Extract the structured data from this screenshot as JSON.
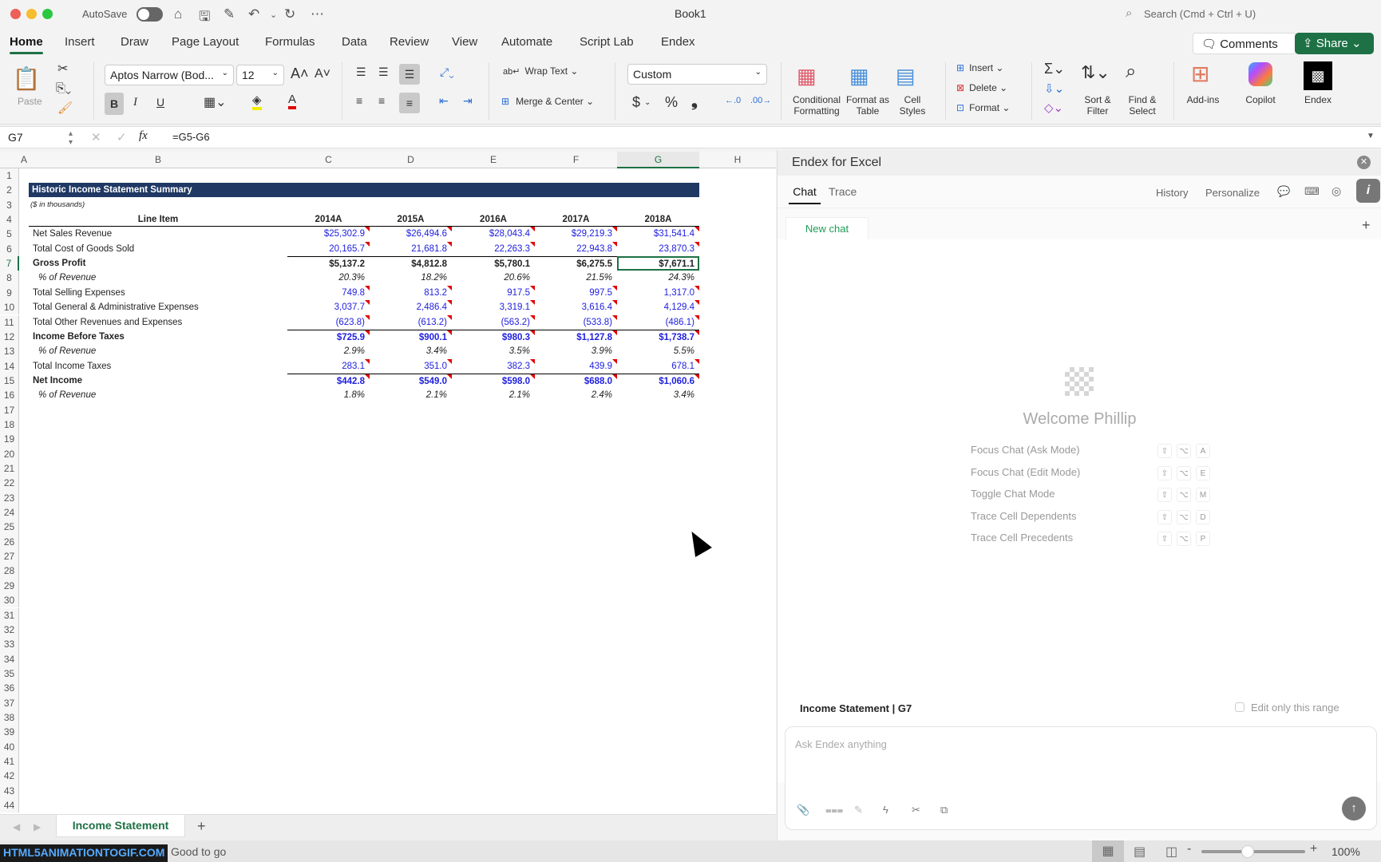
{
  "window": {
    "title": "Book1",
    "autosave_label": "AutoSave",
    "search_placeholder": "Search (Cmd + Ctrl + U)"
  },
  "menu": {
    "tabs": [
      "Home",
      "Insert",
      "Draw",
      "Page Layout",
      "Formulas",
      "Data",
      "Review",
      "View",
      "Automate",
      "Script Lab",
      "Endex"
    ],
    "comments": "Comments",
    "share": "Share"
  },
  "ribbon": {
    "paste": "Paste",
    "font_name": "Aptos Narrow (Bod...",
    "font_size": "12",
    "wrap_text": "Wrap Text",
    "merge_center": "Merge & Center",
    "number_format": "Custom",
    "conditional_formatting": "Conditional Formatting",
    "format_as_table": "Format as Table",
    "cell_styles": "Cell Styles",
    "insert": "Insert",
    "delete": "Delete",
    "format": "Format",
    "sort_filter": "Sort & Filter",
    "find_select": "Find & Select",
    "addins": "Add-ins",
    "copilot": "Copilot",
    "endex": "Endex",
    "bold": "B",
    "italic": "I",
    "underline": "U",
    "currency": "$",
    "percent": "%",
    "comma": "❟"
  },
  "formula_bar": {
    "name_box": "G7",
    "formula": "=G5-G6"
  },
  "sheet": {
    "columns": [
      "A",
      "B",
      "C",
      "D",
      "E",
      "F",
      "G",
      "H"
    ],
    "selected_column": "G",
    "selected_row": 7,
    "title": "Historic Income Statement Summary",
    "subtitle": "($ in thousands)",
    "header": {
      "label": "Line Item",
      "years": [
        "2014A",
        "2015A",
        "2016A",
        "2017A",
        "2018A"
      ]
    },
    "rows": [
      {
        "row": 5,
        "label": "Net Sales Revenue",
        "values": [
          "$25,302.9",
          "$26,494.6",
          "$28,043.4",
          "$29,219.3",
          "$31,541.4"
        ],
        "style": "input"
      },
      {
        "row": 6,
        "label": "Total Cost of Goods Sold",
        "values": [
          "20,165.7",
          "21,681.8",
          "22,263.3",
          "22,943.8",
          "23,870.3"
        ],
        "style": "input"
      },
      {
        "row": 7,
        "label": "Gross Profit",
        "values": [
          "$5,137.2",
          "$4,812.8",
          "$5,780.1",
          "$6,275.5",
          "$7,671.1"
        ],
        "style": "total"
      },
      {
        "row": 8,
        "label": "% of Revenue",
        "values": [
          "20.3%",
          "18.2%",
          "20.6%",
          "21.5%",
          "24.3%"
        ],
        "style": "pct"
      },
      {
        "row": 9,
        "label": "Total Selling Expenses",
        "values": [
          "749.8",
          "813.2",
          "917.5",
          "997.5",
          "1,317.0"
        ],
        "style": "input"
      },
      {
        "row": 10,
        "label": "Total General & Administrative Expenses",
        "values": [
          "3,037.7",
          "2,486.4",
          "3,319.1",
          "3,616.4",
          "4,129.4"
        ],
        "style": "input"
      },
      {
        "row": 11,
        "label": "Total Other Revenues and Expenses",
        "values": [
          "(623.8)",
          "(613.2)",
          "(563.2)",
          "(533.8)",
          "(486.1)"
        ],
        "style": "input"
      },
      {
        "row": 12,
        "label": "Income Before Taxes",
        "values": [
          "$725.9",
          "$900.1",
          "$980.3",
          "$1,127.8",
          "$1,738.7"
        ],
        "style": "input-total"
      },
      {
        "row": 13,
        "label": "% of Revenue",
        "values": [
          "2.9%",
          "3.4%",
          "3.5%",
          "3.9%",
          "5.5%"
        ],
        "style": "pct"
      },
      {
        "row": 14,
        "label": "Total Income Taxes",
        "values": [
          "283.1",
          "351.0",
          "382.3",
          "439.9",
          "678.1"
        ],
        "style": "input"
      },
      {
        "row": 15,
        "label": "Net Income",
        "values": [
          "$442.8",
          "$549.0",
          "$598.0",
          "$688.0",
          "$1,060.6"
        ],
        "style": "input-total"
      },
      {
        "row": 16,
        "label": "% of Revenue",
        "values": [
          "1.8%",
          "2.1%",
          "2.1%",
          "2.4%",
          "3.4%"
        ],
        "style": "pct"
      }
    ],
    "row_count": 44,
    "tabs": [
      "Income Statement"
    ],
    "title_fill": "#1f3864",
    "input_color": "#2020e0"
  },
  "pane": {
    "title": "Endex for Excel",
    "tabs": [
      "Chat",
      "Trace"
    ],
    "actions": [
      "History",
      "Personalize"
    ],
    "chat_tab": "New chat",
    "welcome": "Welcome Phillip",
    "shortcuts": [
      {
        "label": "Focus Chat (Ask Mode)",
        "keys": [
          "⇧",
          "⌥",
          "A"
        ]
      },
      {
        "label": "Focus Chat (Edit Mode)",
        "keys": [
          "⇧",
          "⌥",
          "E"
        ]
      },
      {
        "label": "Toggle Chat Mode",
        "keys": [
          "⇧",
          "⌥",
          "M"
        ]
      },
      {
        "label": "Trace Cell Dependents",
        "keys": [
          "⇧",
          "⌥",
          "D"
        ]
      },
      {
        "label": "Trace Cell Precedents",
        "keys": [
          "⇧",
          "⌥",
          "P"
        ]
      }
    ],
    "context": "Income Statement | G7",
    "edit_only_range": "Edit only this range",
    "input_placeholder": "Ask Endex anything"
  },
  "status": {
    "text": "Good to go",
    "zoom": "100%",
    "watermark": "HTML5ANIMATIONTOGIF.COM"
  }
}
